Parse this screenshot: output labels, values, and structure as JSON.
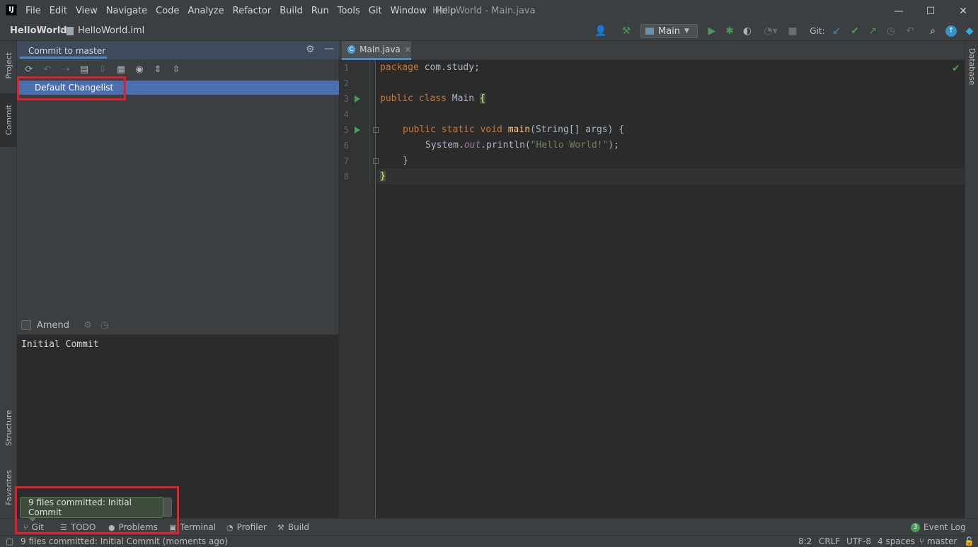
{
  "window": {
    "title": "HelloWorld - Main.java",
    "minimize": "—",
    "maximize": "☐",
    "close": "✕"
  },
  "menu": [
    "File",
    "Edit",
    "View",
    "Navigate",
    "Code",
    "Analyze",
    "Refactor",
    "Build",
    "Run",
    "Tools",
    "Git",
    "Window",
    "Help"
  ],
  "breadcrumb": {
    "project": "HelloWorld",
    "separator": "〉",
    "file": "HelloWorld.iml"
  },
  "toolbar": {
    "run_config": "Main",
    "git_label": "Git:"
  },
  "left_strip": {
    "project": "Project",
    "commit": "Commit",
    "structure": "Structure",
    "favorites": "Favorites"
  },
  "right_strip": {
    "database": "Database"
  },
  "commit_panel": {
    "title": "Commit to master",
    "changelist": "Default Changelist",
    "amend_label": "Amend",
    "message": "Initial Commit"
  },
  "editor": {
    "tab_label": "Main.java",
    "lines": [
      {
        "n": "1"
      },
      {
        "n": "2"
      },
      {
        "n": "3"
      },
      {
        "n": "4"
      },
      {
        "n": "5"
      },
      {
        "n": "6"
      },
      {
        "n": "7"
      },
      {
        "n": "8"
      }
    ],
    "code": {
      "l1_kw": "package",
      "l1_rest": " com.study;",
      "l3_kw": "public class",
      "l3_name": " Main ",
      "l3_brace": "{",
      "l5_kw": "public static void",
      "l5_fn": "main",
      "l5_rest": "(String[] args) {",
      "l6_a": "System.",
      "l6_it": "out",
      "l6_b": ".println(",
      "l6_str": "\"Hello World!\"",
      "l6_c": ");",
      "l7": "}",
      "l8": "}"
    }
  },
  "bottom_tabs": {
    "git": "Git",
    "todo": "TODO",
    "problems": "Problems",
    "terminal": "Terminal",
    "profiler": "Profiler",
    "build": "Build",
    "event_log": "Event Log",
    "event_count": "3"
  },
  "notification": {
    "text": "9 files committed: Initial Commit"
  },
  "status": {
    "message": "9 files committed: Initial Commit (moments ago)",
    "position": "8:2",
    "line_sep": "CRLF",
    "encoding": "UTF-8",
    "indent": "4 spaces",
    "branch": "master"
  },
  "colors": {
    "accent": "#4a88c7",
    "selection": "#4b6eaf",
    "highlight_box": "#e0202b",
    "run_green": "#499c54"
  }
}
